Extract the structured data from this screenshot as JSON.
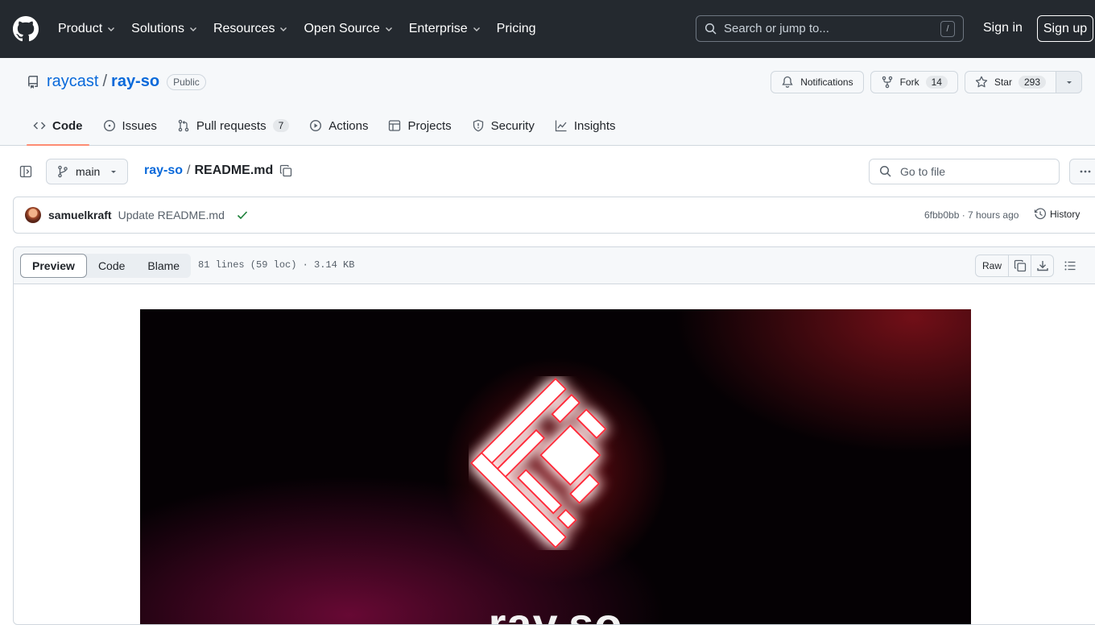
{
  "header": {
    "nav": [
      {
        "label": "Product",
        "dropdown": true
      },
      {
        "label": "Solutions",
        "dropdown": true
      },
      {
        "label": "Resources",
        "dropdown": true
      },
      {
        "label": "Open Source",
        "dropdown": true
      },
      {
        "label": "Enterprise",
        "dropdown": true
      },
      {
        "label": "Pricing",
        "dropdown": false
      }
    ],
    "search_placeholder": "Search or jump to...",
    "search_shortcut": "/",
    "sign_in": "Sign in",
    "sign_up": "Sign up"
  },
  "repo": {
    "owner": "raycast",
    "separator": "/",
    "name": "ray-so",
    "visibility": "Public",
    "notifications_label": "Notifications",
    "fork_label": "Fork",
    "fork_count": "14",
    "star_label": "Star",
    "star_count": "293",
    "tabs": [
      {
        "label": "Code",
        "icon": "code-icon",
        "active": true
      },
      {
        "label": "Issues",
        "icon": "issue-icon"
      },
      {
        "label": "Pull requests",
        "icon": "pull-request-icon",
        "count": "7"
      },
      {
        "label": "Actions",
        "icon": "play-icon"
      },
      {
        "label": "Projects",
        "icon": "table-icon"
      },
      {
        "label": "Security",
        "icon": "shield-icon"
      },
      {
        "label": "Insights",
        "icon": "graph-icon"
      }
    ]
  },
  "file_nav": {
    "branch": "main",
    "crumb_repo": "ray-so",
    "crumb_sep": "/",
    "crumb_file": "README.md",
    "goto_placeholder": "Go to file"
  },
  "commit": {
    "author": "samuelkraft",
    "message": "Update README.md",
    "meta": "6fbb0bb · 7 hours ago",
    "history_label": "History"
  },
  "viewer": {
    "tabs": [
      "Preview",
      "Code",
      "Blame"
    ],
    "active_tab": "Preview",
    "file_info": "81 lines (59 loc) · 3.14 KB",
    "raw_label": "Raw"
  },
  "readme": {
    "hero_text": "ray.so"
  },
  "colors": {
    "header_bg": "#24292f",
    "link": "#0969da",
    "tab_underline": "#fd8c73",
    "success": "#1a7f37",
    "hero_red": "#e0202a"
  }
}
